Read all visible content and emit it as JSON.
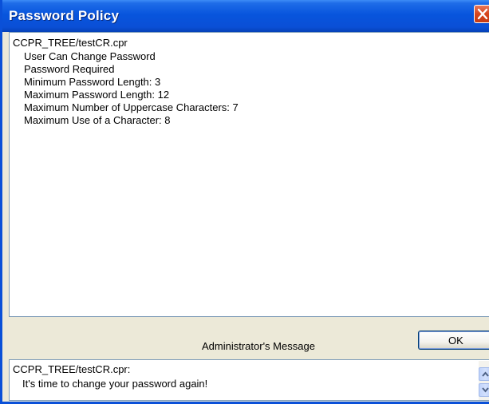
{
  "window": {
    "title": "Password Policy"
  },
  "policy": {
    "header": "CCPR_TREE/testCR.cpr",
    "lines": [
      "User Can Change Password",
      "Password Required",
      "Minimum Password Length: 3",
      "Maximum Password Length: 12",
      "Maximum Number of Uppercase Characters: 7",
      "Maximum Use of a Character: 8"
    ]
  },
  "buttons": {
    "ok_label": "OK"
  },
  "admin": {
    "label": "Administrator's Message",
    "message_header": "CCPR_TREE/testCR.cpr:",
    "message_text": "It's time to change your password again!"
  },
  "icons": {
    "close": "close-icon",
    "scroll_up": "scroll-up-arrow-icon",
    "scroll_down": "scroll-down-arrow-icon"
  },
  "colors": {
    "titlebar": "#0a50d8",
    "close_button": "#d6451c",
    "window_bg": "#ece9d8"
  }
}
